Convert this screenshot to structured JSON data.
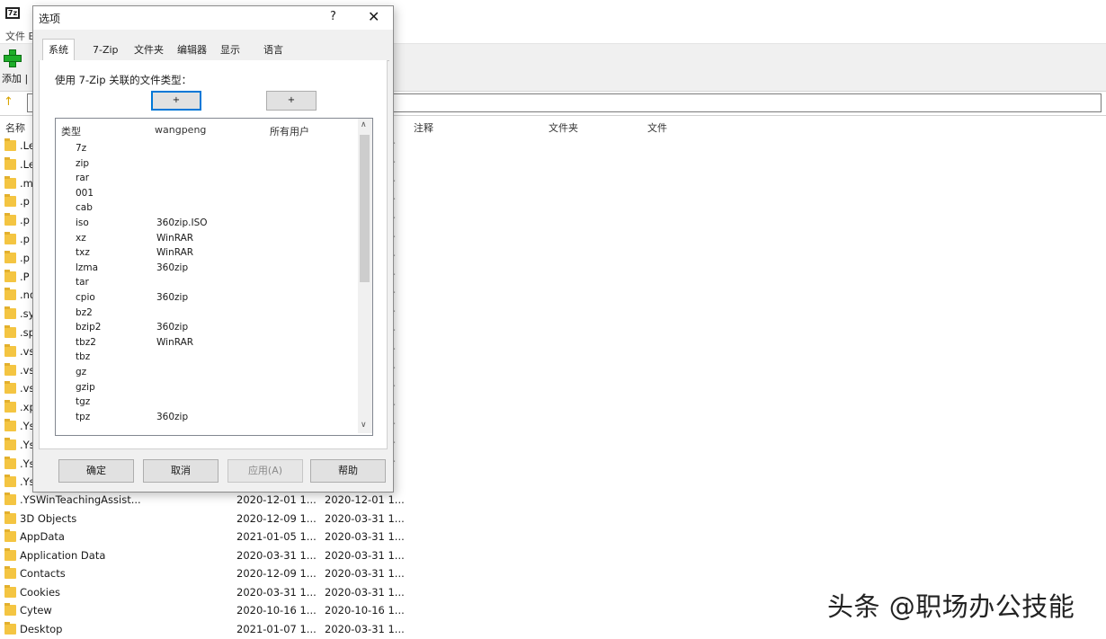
{
  "background": {
    "menu_label": "文件 E",
    "toolbar_add_label": "添加 |",
    "columns": [
      "名称",
      "注释",
      "文件夹",
      "文件"
    ],
    "partial_rows": [
      ".Le",
      ".Le",
      ".m",
      ".p",
      ".p",
      ".p",
      ".p",
      ".P",
      ".nd",
      ".sy",
      ".sp",
      ".vs",
      ".vs",
      ".vs",
      ".xp",
      ".Ys",
      ".Ys",
      ".Ys",
      ".Ys"
    ],
    "files": [
      {
        "name": ".YSWinTeachingAssist...",
        "modified": "2020-12-01 1...",
        "created": "2020-12-01 1..."
      },
      {
        "name": "3D Objects",
        "modified": "2020-12-09 1...",
        "created": "2020-03-31 1..."
      },
      {
        "name": "AppData",
        "modified": "2021-01-05 1...",
        "created": "2020-03-31 1..."
      },
      {
        "name": "Application Data",
        "modified": "2020-03-31 1...",
        "created": "2020-03-31 1..."
      },
      {
        "name": "Contacts",
        "modified": "2020-12-09 1...",
        "created": "2020-03-31 1..."
      },
      {
        "name": "Cookies",
        "modified": "2020-03-31 1...",
        "created": "2020-03-31 1..."
      },
      {
        "name": "Cytew",
        "modified": "2020-10-16 1...",
        "created": "2020-10-16 1..."
      },
      {
        "name": "Desktop",
        "modified": "2021-01-07 1...",
        "created": "2020-03-31 1..."
      }
    ]
  },
  "dialog": {
    "title": "选项",
    "help": "?",
    "close": "✕",
    "tabs": [
      "系统",
      "7-Zip",
      "文件夹",
      "编辑器",
      "显示",
      "语言"
    ],
    "assoc_label": "使用 7-Zip 关联的文件类型：",
    "assoc_buttons": [
      "+",
      "+"
    ],
    "list_headers": [
      "类型",
      "wangpeng",
      "所有用户"
    ],
    "rows": [
      {
        "ext": "7z",
        "user": ""
      },
      {
        "ext": "zip",
        "user": ""
      },
      {
        "ext": "rar",
        "user": ""
      },
      {
        "ext": "001",
        "user": ""
      },
      {
        "ext": "cab",
        "user": ""
      },
      {
        "ext": "iso",
        "user": "360zip.ISO"
      },
      {
        "ext": "xz",
        "user": "WinRAR"
      },
      {
        "ext": "txz",
        "user": "WinRAR"
      },
      {
        "ext": "lzma",
        "user": "360zip"
      },
      {
        "ext": "tar",
        "user": ""
      },
      {
        "ext": "cpio",
        "user": "360zip"
      },
      {
        "ext": "bz2",
        "user": ""
      },
      {
        "ext": "bzip2",
        "user": "360zip"
      },
      {
        "ext": "tbz2",
        "user": "WinRAR"
      },
      {
        "ext": "tbz",
        "user": ""
      },
      {
        "ext": "gz",
        "user": ""
      },
      {
        "ext": "gzip",
        "user": ""
      },
      {
        "ext": "tgz",
        "user": ""
      },
      {
        "ext": "tpz",
        "user": "360zip"
      }
    ],
    "buttons": {
      "ok": "确定",
      "cancel": "取消",
      "apply": "应用(A)",
      "help": "帮助"
    }
  },
  "watermark": "头条 @职场办公技能"
}
